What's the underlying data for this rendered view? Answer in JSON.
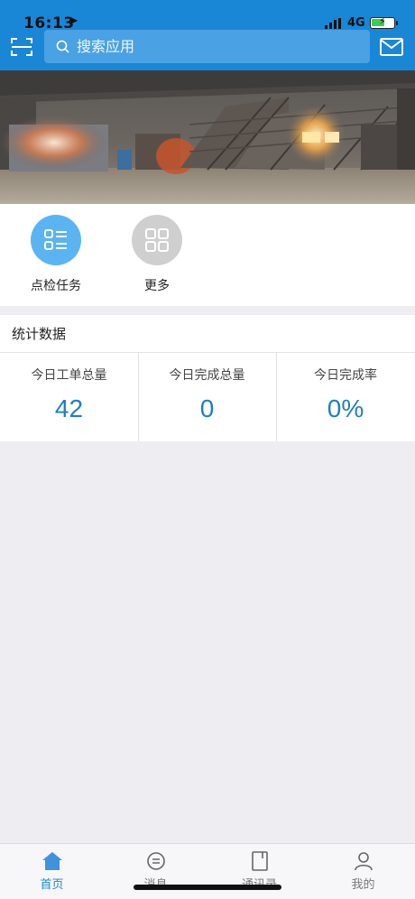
{
  "status_bar": {
    "time": "16:13",
    "network": "4G"
  },
  "header": {
    "search_placeholder": "搜索应用",
    "brand_color": "#1a86d6"
  },
  "apps": [
    {
      "label": "点检任务",
      "icon": "list-icon",
      "color": "#5ab4f2"
    },
    {
      "label": "更多",
      "icon": "grid-icon",
      "color": "#cfcfcf"
    }
  ],
  "stats": {
    "title": "统计数据",
    "items": [
      {
        "label": "今日工单总量",
        "value": "42"
      },
      {
        "label": "今日完成总量",
        "value": "0"
      },
      {
        "label": "今日完成率",
        "value": "0%"
      }
    ]
  },
  "tabs": [
    {
      "label": "首页",
      "icon": "home-icon",
      "active": true
    },
    {
      "label": "消息",
      "icon": "message-icon",
      "active": false
    },
    {
      "label": "通讯录",
      "icon": "contacts-icon",
      "active": false
    },
    {
      "label": "我的",
      "icon": "user-icon",
      "active": false
    }
  ],
  "colors": {
    "accent": "#1a86d6",
    "stat_value": "#1b7fc4"
  }
}
